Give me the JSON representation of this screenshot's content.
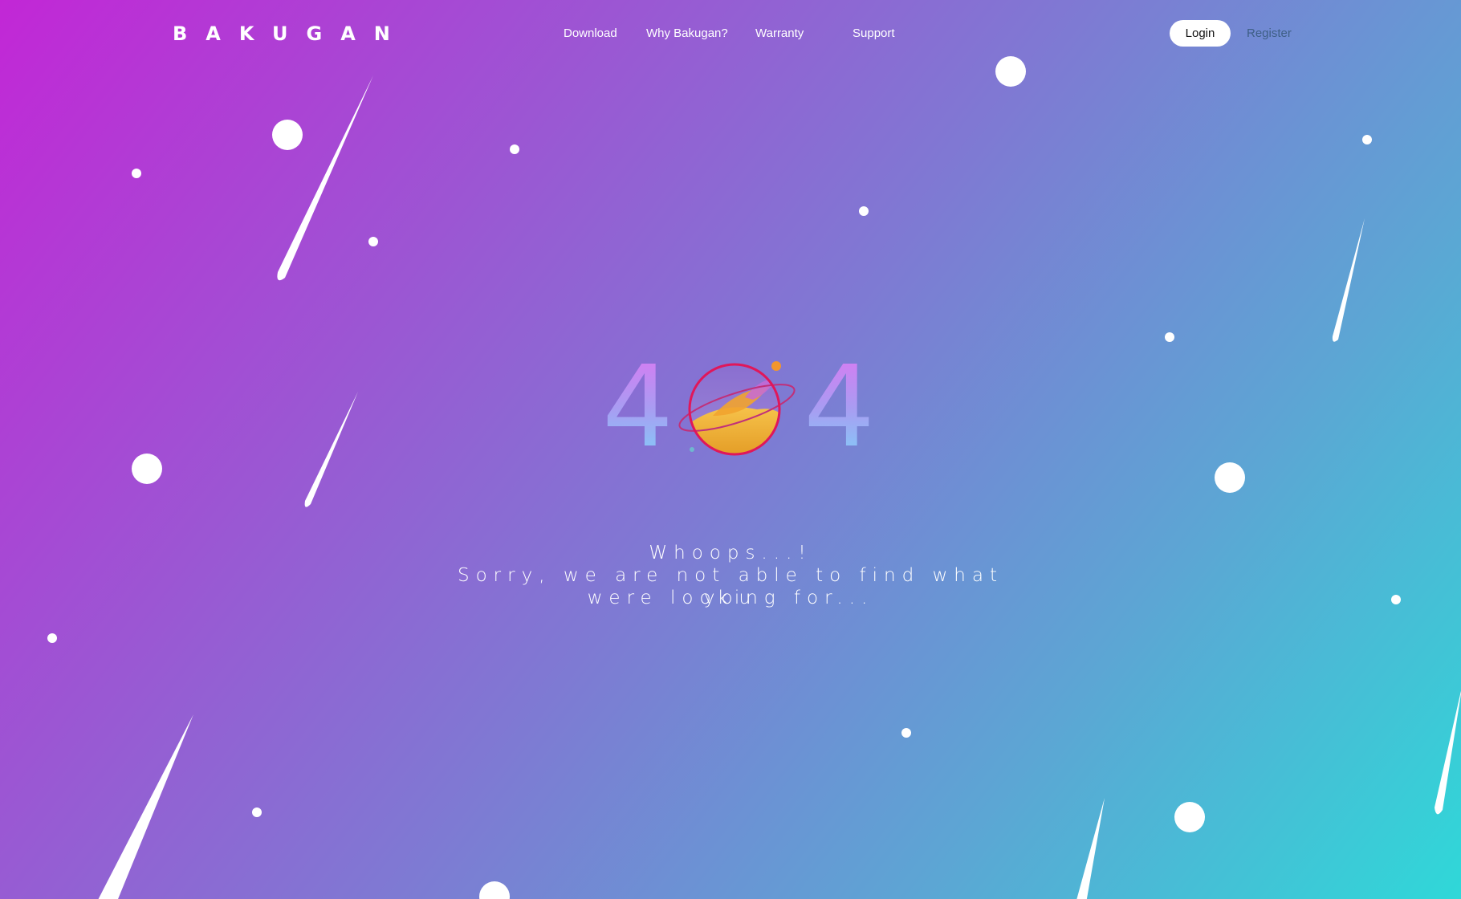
{
  "header": {
    "logo": "BAKUGAN",
    "nav": {
      "download": "Download",
      "why": "Why Bakugan?",
      "warranty": "Warranty",
      "support": "Support"
    },
    "login": "Login",
    "register": "Register"
  },
  "error": {
    "digit_left": "4",
    "digit_right": "4",
    "title": "Whoops...!",
    "line1": "Sorry, we are not able to find what you",
    "line2": "were looking for..."
  },
  "colors": {
    "gradient_start": "#c227d6",
    "gradient_end": "#2fd8d8",
    "planet_ring": "#e0175a",
    "planet_body": "#f2b233"
  },
  "icons": {
    "planet": "planet-zero-icon",
    "stars": "star-dot-icon",
    "meteors": "meteor-icon"
  }
}
